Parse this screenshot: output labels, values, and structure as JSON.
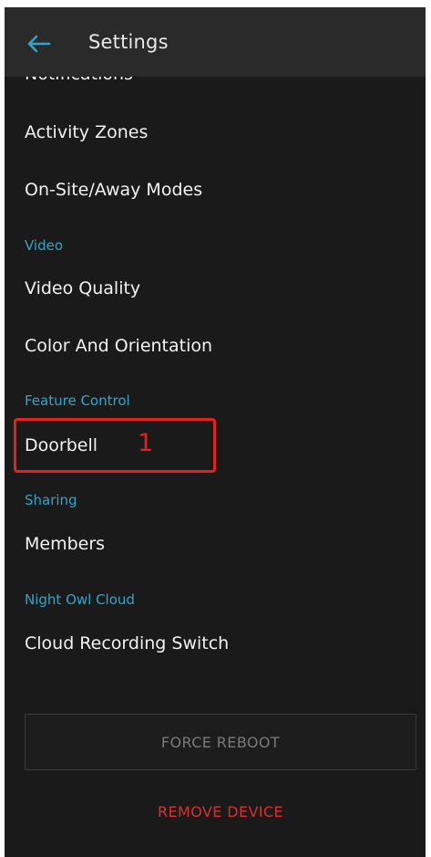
{
  "appbar": {
    "title": "Settings",
    "back_icon": "arrow-left-icon"
  },
  "items": {
    "notifications": "Notifications",
    "activity_zones": "Activity Zones",
    "onsite_away": "On-Site/Away Modes",
    "video_quality": "Video Quality",
    "color_orientation": "Color And Orientation",
    "doorbell": "Doorbell",
    "members": "Members",
    "cloud_recording": "Cloud Recording Switch"
  },
  "sections": {
    "video": "Video",
    "feature_control": "Feature Control",
    "sharing": "Sharing",
    "night_owl_cloud": "Night Owl Cloud"
  },
  "annotation": {
    "number": "1"
  },
  "buttons": {
    "force_reboot": "FORCE REBOOT",
    "remove_device": "REMOVE DEVICE"
  },
  "colors": {
    "accent": "#2fa6c9",
    "danger": "#d9302b",
    "highlight": "#e02222",
    "background": "#1a1a1a",
    "appbar": "#2a2a2a"
  }
}
